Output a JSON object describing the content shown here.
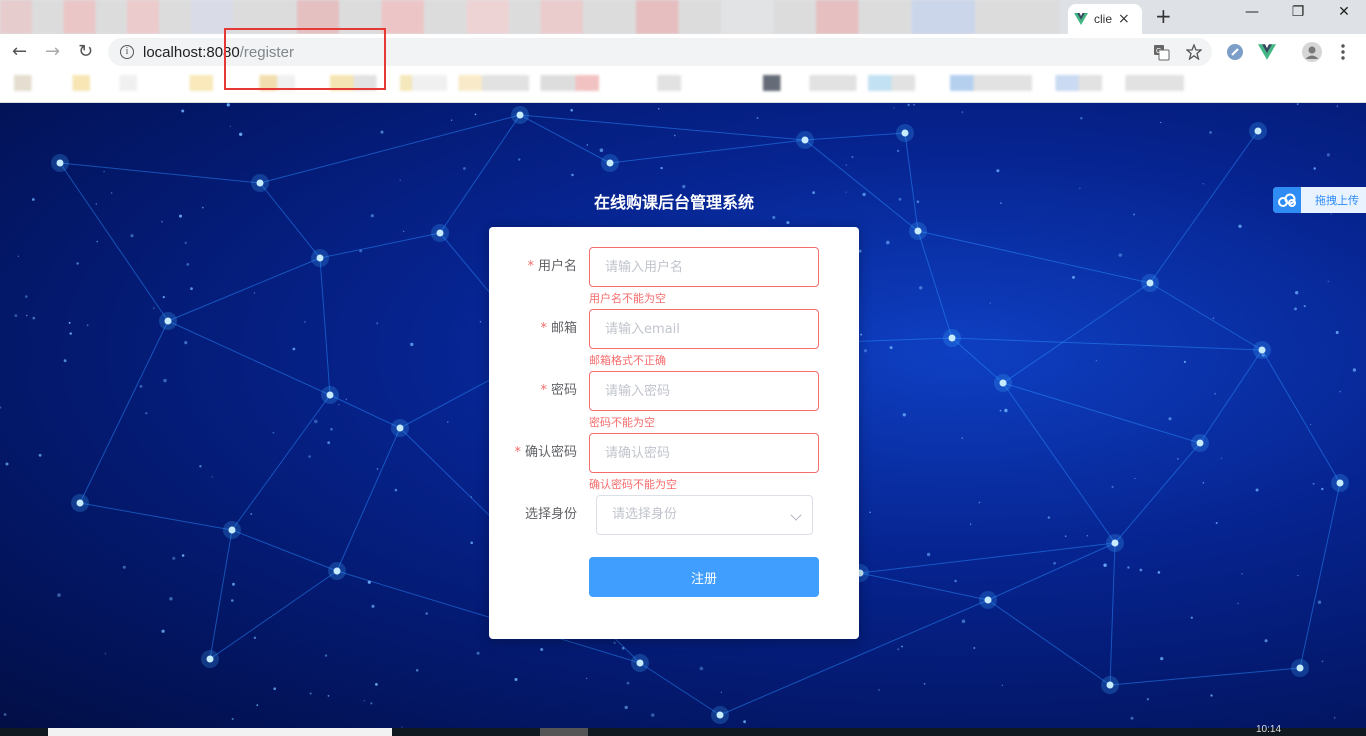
{
  "browser": {
    "tab": {
      "title": "clie",
      "favicon": "vue-logo-icon",
      "close": "×"
    },
    "new_tab": "+",
    "window_controls": {
      "minimize": "—",
      "restore": "❐",
      "close": "✕"
    },
    "nav": {
      "back": "←",
      "forward": "→",
      "reload": "↻"
    },
    "address": {
      "host": "localhost:8080",
      "path": "/register"
    },
    "omnibox_icons": [
      "translate-icon",
      "bookmark-star-icon"
    ],
    "extensions": [
      "extension-icon",
      "vue-devtools-icon",
      "profile-avatar",
      "menu-icon"
    ],
    "colors": {
      "highlight_box": "#e53935",
      "vue_green": "#41b883"
    }
  },
  "page": {
    "title": "在线购课后台管理系统",
    "colors": {
      "background": "#06238e",
      "primary": "#409eff",
      "error": "#f56c6c"
    }
  },
  "form": {
    "required_mark": "*",
    "username": {
      "label": "用户名",
      "placeholder": "请输入用户名",
      "value": "",
      "error": "用户名不能为空"
    },
    "email": {
      "label": "邮箱",
      "placeholder": "请输入email",
      "value": "",
      "error": "邮箱格式不正确"
    },
    "password": {
      "label": "密码",
      "placeholder": "请输入密码",
      "value": "",
      "error": "密码不能为空"
    },
    "confirm_password": {
      "label": "确认密码",
      "placeholder": "请确认密码",
      "value": "",
      "error": "确认密码不能为空"
    },
    "role": {
      "label": "选择身份",
      "placeholder": "请选择身份"
    },
    "submit_label": "注册"
  },
  "upload_widget": {
    "label": "拖拽上传"
  },
  "taskbar": {
    "clock": "10:14"
  }
}
